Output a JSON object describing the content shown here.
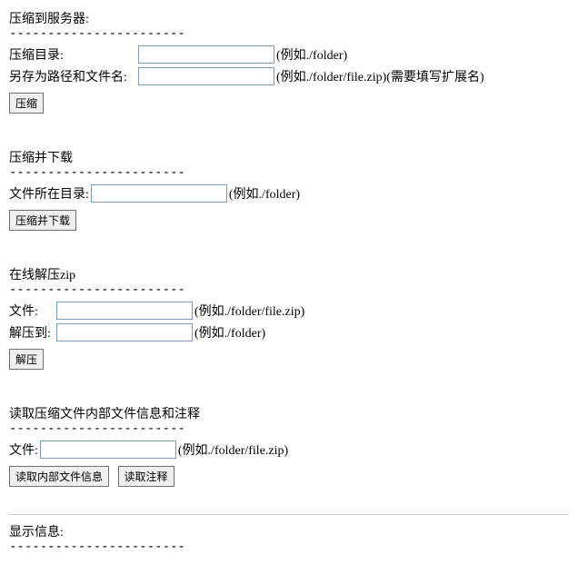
{
  "sections": {
    "compressToServer": {
      "title": "压缩到服务器:",
      "dashes": "-----------------------",
      "dirLabel": "压缩目录:",
      "dirHint": "(例如./folder)",
      "saveLabel": "另存为路径和文件名:",
      "saveHint": "(例如./folder/file.zip)(需要填写扩展名)",
      "button": "压缩"
    },
    "compressDownload": {
      "title": "压缩并下载",
      "dashes": "-----------------------",
      "dirLabel": "文件所在目录:",
      "dirHint": "(例如./folder)",
      "button": "压缩并下载"
    },
    "unzip": {
      "title": "在线解压zip",
      "dashes": "-----------------------",
      "fileLabel": "文件:",
      "fileHint": "(例如./folder/file.zip)",
      "destLabel": "解压到:",
      "destHint": "(例如./folder)",
      "button": "解压"
    },
    "readInfo": {
      "title": "读取压缩文件内部文件信息和注释",
      "dashes": "-----------------------",
      "fileLabel": "文件:",
      "fileHint": "(例如./folder/file.zip)",
      "button1": "读取内部文件信息",
      "button2": "读取注释"
    },
    "showInfo": {
      "title": "显示信息:",
      "dashes": "-----------------------"
    }
  }
}
